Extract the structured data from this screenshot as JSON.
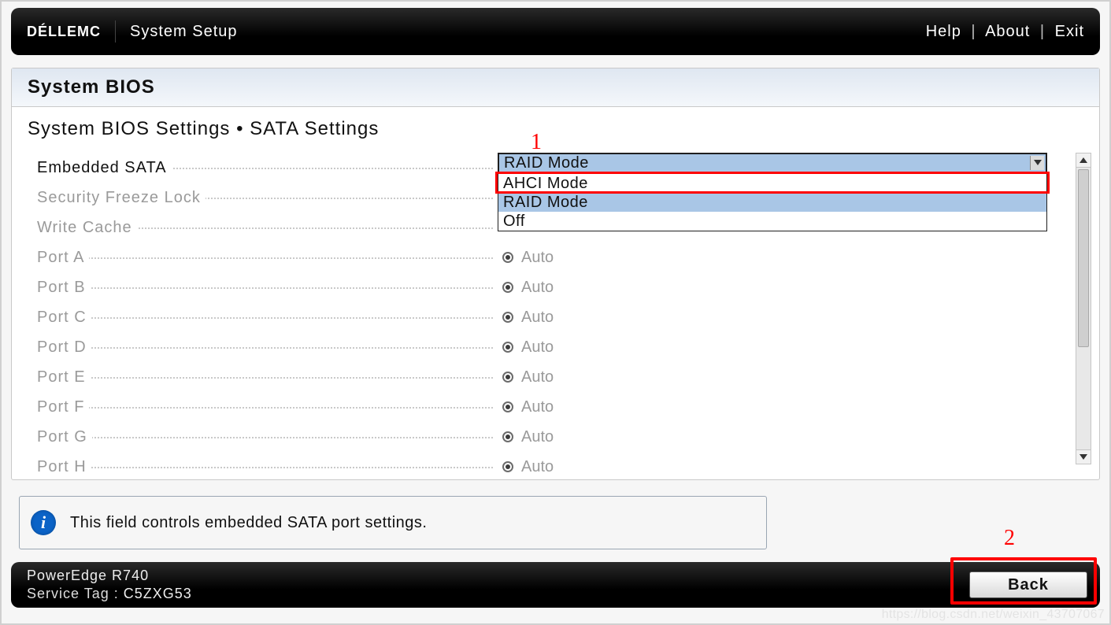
{
  "topbar": {
    "brand_logo": "DÉLLEMC",
    "title": "System Setup",
    "links": {
      "help": "Help",
      "about": "About",
      "exit": "Exit"
    },
    "separator": "|"
  },
  "card": {
    "title": "System BIOS",
    "breadcrumb": "System BIOS Settings • SATA Settings"
  },
  "settings": {
    "embedded_sata": {
      "label": "Embedded SATA",
      "selected": "RAID Mode",
      "options": [
        "AHCI Mode",
        "RAID Mode",
        "Off"
      ]
    },
    "security_freeze_lock": {
      "label": "Security Freeze Lock"
    },
    "write_cache": {
      "label": "Write Cache"
    },
    "ports": [
      {
        "label": "Port A",
        "value": "Auto"
      },
      {
        "label": "Port B",
        "value": "Auto"
      },
      {
        "label": "Port C",
        "value": "Auto"
      },
      {
        "label": "Port D",
        "value": "Auto"
      },
      {
        "label": "Port E",
        "value": "Auto"
      },
      {
        "label": "Port F",
        "value": "Auto"
      },
      {
        "label": "Port G",
        "value": "Auto"
      },
      {
        "label": "Port H",
        "value": "Auto"
      }
    ]
  },
  "info_box": {
    "text": "This field controls embedded SATA port settings."
  },
  "bottombar": {
    "model": "PowerEdge R740",
    "service_tag_label": "Service Tag :",
    "service_tag_value": "C5ZXG53",
    "back_label": "Back"
  },
  "annotations": {
    "num1": "1",
    "num2": "2"
  },
  "watermark": "https://blog.csdn.net/weixin_43707067",
  "colors": {
    "accent_red": "#ff0000",
    "selection_blue": "#a9c6e6",
    "info_blue": "#0b63c7"
  }
}
